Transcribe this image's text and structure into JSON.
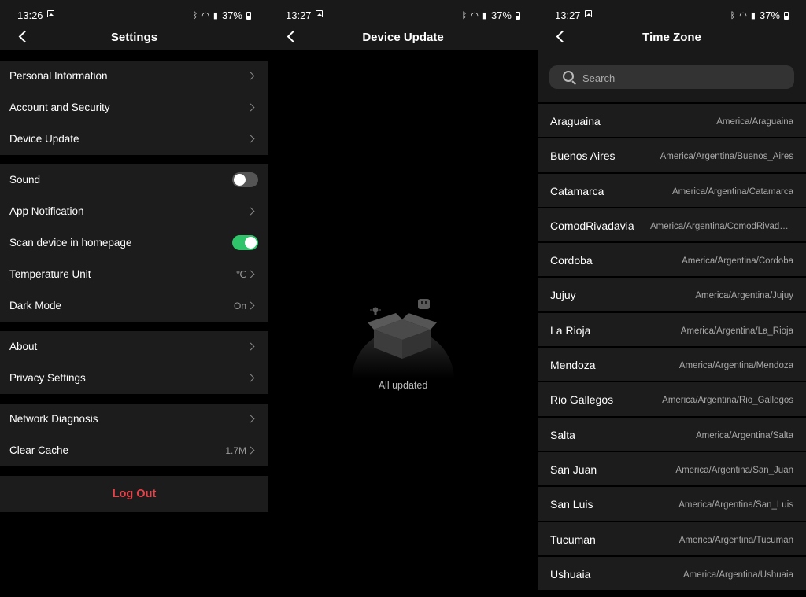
{
  "settings_screen": {
    "status": {
      "time": "13:26",
      "battery": "37%"
    },
    "title": "Settings",
    "groups": [
      {
        "items": [
          {
            "label": "Personal Information"
          },
          {
            "label": "Account and Security"
          },
          {
            "label": "Device Update"
          }
        ]
      },
      {
        "items": [
          {
            "label": "Sound",
            "toggle": false
          },
          {
            "label": "App Notification"
          },
          {
            "label": "Scan device in homepage",
            "toggle": true
          },
          {
            "label": "Temperature Unit",
            "value": "℃"
          },
          {
            "label": "Dark Mode",
            "value": "On"
          }
        ]
      },
      {
        "items": [
          {
            "label": "About"
          },
          {
            "label": "Privacy Settings"
          }
        ]
      },
      {
        "items": [
          {
            "label": "Network Diagnosis"
          },
          {
            "label": "Clear Cache",
            "value": "1.7M"
          }
        ]
      }
    ],
    "logout_label": "Log Out",
    "logout_color": "#e5434a",
    "toggle_on_color": "#2fc46a"
  },
  "device_update_screen": {
    "status": {
      "time": "13:27",
      "battery": "37%"
    },
    "title": "Device Update",
    "empty_text": "All updated"
  },
  "timezone_screen": {
    "status": {
      "time": "13:27",
      "battery": "37%"
    },
    "title": "Time Zone",
    "search_placeholder": "Search",
    "zones": [
      {
        "city": "Araguaina",
        "zone": "America/Araguaina"
      },
      {
        "city": "Buenos Aires",
        "zone": "America/Argentina/Buenos_Aires"
      },
      {
        "city": "Catamarca",
        "zone": "America/Argentina/Catamarca"
      },
      {
        "city": "ComodRivadavia",
        "zone": "America/Argentina/ComodRivadavia"
      },
      {
        "city": "Cordoba",
        "zone": "America/Argentina/Cordoba"
      },
      {
        "city": "Jujuy",
        "zone": "America/Argentina/Jujuy"
      },
      {
        "city": "La Rioja",
        "zone": "America/Argentina/La_Rioja"
      },
      {
        "city": "Mendoza",
        "zone": "America/Argentina/Mendoza"
      },
      {
        "city": "Rio Gallegos",
        "zone": "America/Argentina/Rio_Gallegos"
      },
      {
        "city": "Salta",
        "zone": "America/Argentina/Salta"
      },
      {
        "city": "San Juan",
        "zone": "America/Argentina/San_Juan"
      },
      {
        "city": "San Luis",
        "zone": "America/Argentina/San_Luis"
      },
      {
        "city": "Tucuman",
        "zone": "America/Argentina/Tucuman"
      },
      {
        "city": "Ushuaia",
        "zone": "America/Argentina/Ushuaia"
      }
    ]
  }
}
